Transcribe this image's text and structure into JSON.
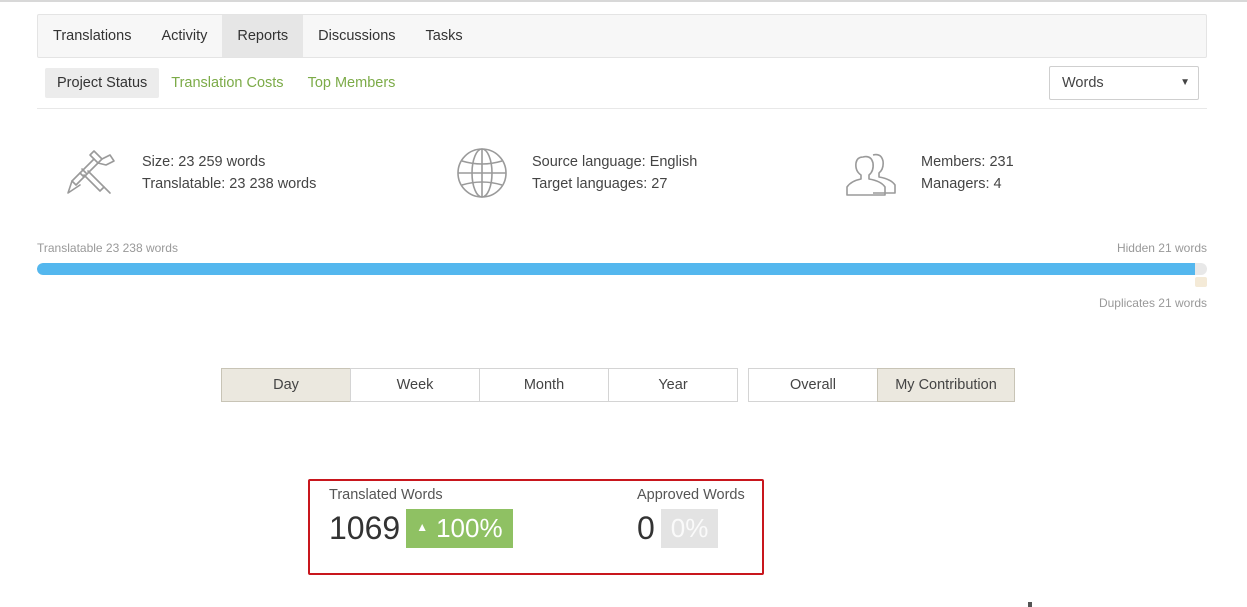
{
  "main_tabs": [
    {
      "label": "Translations",
      "active": false
    },
    {
      "label": "Activity",
      "active": false
    },
    {
      "label": "Reports",
      "active": true
    },
    {
      "label": "Discussions",
      "active": false
    },
    {
      "label": "Tasks",
      "active": false
    }
  ],
  "sub_tabs": [
    {
      "label": "Project Status",
      "active": true
    },
    {
      "label": "Translation Costs",
      "active": false
    },
    {
      "label": "Top Members",
      "active": false
    }
  ],
  "unit_select": {
    "value": "Words"
  },
  "stats": {
    "size": {
      "line1": "Size: 23 259 words",
      "line2": "Translatable: 23 238 words"
    },
    "languages": {
      "line1": "Source language: English",
      "line2": "Target languages: 27"
    },
    "members": {
      "line1": "Members: 231",
      "line2": "Managers: 4"
    }
  },
  "progress": {
    "translatable_label": "Translatable 23 238 words",
    "hidden_label": "Hidden 21 words",
    "duplicates_label": "Duplicates 21 words",
    "fill_fraction": 0.99
  },
  "period_buttons": [
    {
      "label": "Day",
      "active": true
    },
    {
      "label": "Week",
      "active": false
    },
    {
      "label": "Month",
      "active": false
    },
    {
      "label": "Year",
      "active": false
    }
  ],
  "scope_buttons": [
    {
      "label": "Overall",
      "active": false
    },
    {
      "label": "My Contribution",
      "active": true
    }
  ],
  "summary": {
    "translated": {
      "label": "Translated Words",
      "value": "1069",
      "change": "100%",
      "change_icon": "▲"
    },
    "approved": {
      "label": "Approved Words",
      "value": "0",
      "change": "0%"
    }
  },
  "colors": {
    "accent_green": "#7cab48",
    "progress_blue": "#54b7ee",
    "highlight_red": "#c8161d",
    "badge_green": "#8fc163"
  }
}
